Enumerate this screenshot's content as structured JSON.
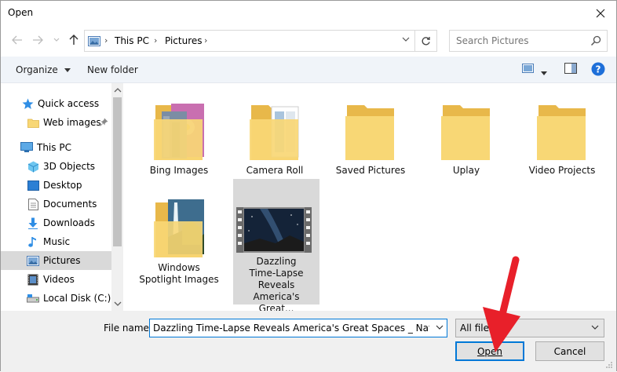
{
  "window": {
    "title": "Open"
  },
  "breadcrumb": [
    "This PC",
    "Pictures"
  ],
  "search": {
    "placeholder": "Search Pictures"
  },
  "toolbar": {
    "organize": "Organize",
    "new_folder": "New folder",
    "help": "?"
  },
  "sidebar": {
    "items": [
      {
        "label": "Quick access",
        "icon": "star-icon"
      },
      {
        "label": "Web images",
        "icon": "folder-icon",
        "pinned": true
      },
      {
        "label": "This PC",
        "icon": "monitor-icon"
      },
      {
        "label": "3D Objects",
        "icon": "cube-icon"
      },
      {
        "label": "Desktop",
        "icon": "desktop-icon"
      },
      {
        "label": "Documents",
        "icon": "document-icon"
      },
      {
        "label": "Downloads",
        "icon": "download-icon"
      },
      {
        "label": "Music",
        "icon": "music-note-icon"
      },
      {
        "label": "Pictures",
        "icon": "pictures-icon",
        "selected": true
      },
      {
        "label": "Videos",
        "icon": "video-icon"
      },
      {
        "label": "Local Disk (C:)",
        "icon": "drive-icon"
      }
    ]
  },
  "files": [
    {
      "name": "Bing Images",
      "type": "folder-photos"
    },
    {
      "name": "Camera Roll",
      "type": "folder-doc"
    },
    {
      "name": "Saved Pictures",
      "type": "folder"
    },
    {
      "name": "Uplay",
      "type": "folder"
    },
    {
      "name": "Video Projects",
      "type": "folder"
    },
    {
      "name": "Windows Spotlight Images",
      "type": "folder-photos2"
    },
    {
      "name": "Dazzling Time-Lapse Reveals America's Great...",
      "type": "video",
      "selected": true
    }
  ],
  "footer": {
    "file_name_label": "File name:",
    "file_name_value": "Dazzling Time-Lapse Reveals America's Great Spaces _ National Geo",
    "file_type": "All file",
    "open_label": "Open",
    "cancel_label": "Cancel"
  },
  "colors": {
    "accent": "#0078d7",
    "folder": "#f8d775",
    "folder_dark": "#e8b84a",
    "arrow": "#e8202a",
    "selected": "#d9d9d9"
  }
}
